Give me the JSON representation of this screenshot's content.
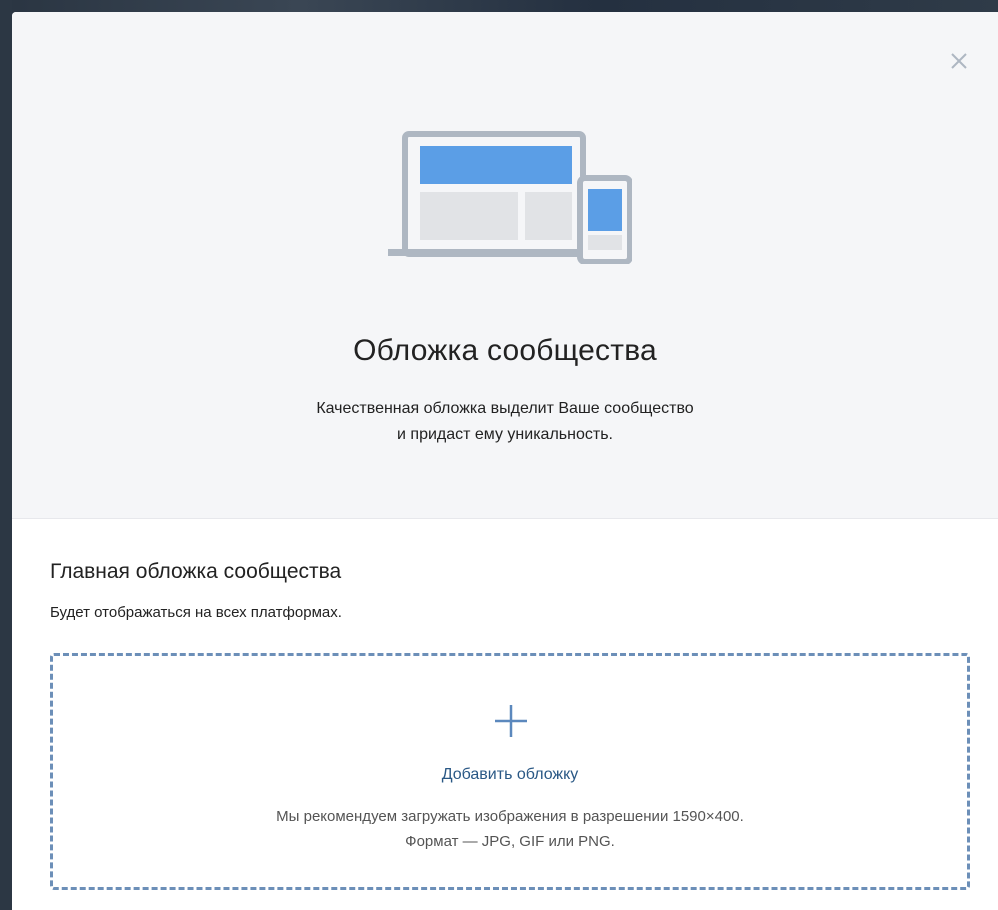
{
  "modal": {
    "title": "Обложка сообщества",
    "subtitle_line1": "Качественная обложка выделит Ваше сообщество",
    "subtitle_line2": "и придаст ему уникальность."
  },
  "section": {
    "title": "Главная обложка сообщества",
    "description": "Будет отображаться на всех платформах."
  },
  "upload": {
    "add_label": "Добавить обложку",
    "hint_line1": "Мы рекомендуем загружать изображения в разрешении 1590×400.",
    "hint_line2": "Формат — JPG, GIF или PNG."
  },
  "icons": {
    "close": "close-icon",
    "illustration": "devices-illustration",
    "plus": "plus-icon"
  },
  "colors": {
    "accent_blue": "#5b9ee6",
    "link_blue": "#2a5885",
    "dashed_border": "#6c8fb8",
    "header_bg": "#f5f6f8"
  }
}
